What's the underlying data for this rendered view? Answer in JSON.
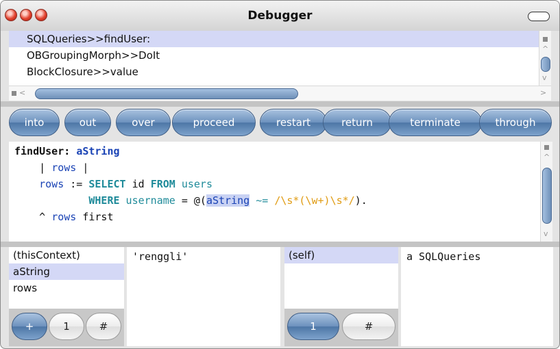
{
  "window": {
    "title": "Debugger"
  },
  "stack": {
    "items": [
      {
        "label": "SQLQueries>>findUser:",
        "selected": true
      },
      {
        "label": "OBGroupingMorph>>DoIt",
        "selected": false
      },
      {
        "label": "BlockClosure>>value",
        "selected": false
      }
    ]
  },
  "toolbar": {
    "into": "into",
    "out": "out",
    "over": "over",
    "proceed": "proceed",
    "restart": "restart",
    "return": "return",
    "terminate": "terminate",
    "through": "through"
  },
  "code": {
    "line1_selector": "findUser:",
    "line1_arg": "aString",
    "line2_bar_open": "| ",
    "line2_temp": "rows",
    "line2_bar_close": " |",
    "line3_var": "rows",
    "line3_assign": " := ",
    "line3_select": "SELECT",
    "line3_id": " id ",
    "line3_from": "FROM",
    "line3_table": " users",
    "line4_where": "WHERE",
    "line4_col": " username ",
    "line4_eq": "= @(",
    "line4_arg": "aString",
    "line4_match": " ~= ",
    "line4_regex": "/\\s*(\\w+)\\s*/",
    "line4_end": ").",
    "line5_caret": "^ ",
    "line5_var": "rows",
    "line5_msg": " first"
  },
  "context_inspector": {
    "items": [
      {
        "label": "(thisContext)",
        "selected": false
      },
      {
        "label": "aString",
        "selected": true
      },
      {
        "label": "rows",
        "selected": false
      }
    ],
    "value": "'renggli'",
    "buttons": {
      "plus": "+",
      "one": "1",
      "hash": "#"
    }
  },
  "receiver_inspector": {
    "items": [
      {
        "label": "(self)",
        "selected": true
      }
    ],
    "value": "a SQLQueries",
    "buttons": {
      "one": "1",
      "hash": "#"
    }
  },
  "colors": {
    "selection": "#d4d8f6",
    "button_blue": "#6c91bd",
    "keyword": "#1f8b9a",
    "argument": "#1a43b5",
    "regex": "#e09b12"
  }
}
